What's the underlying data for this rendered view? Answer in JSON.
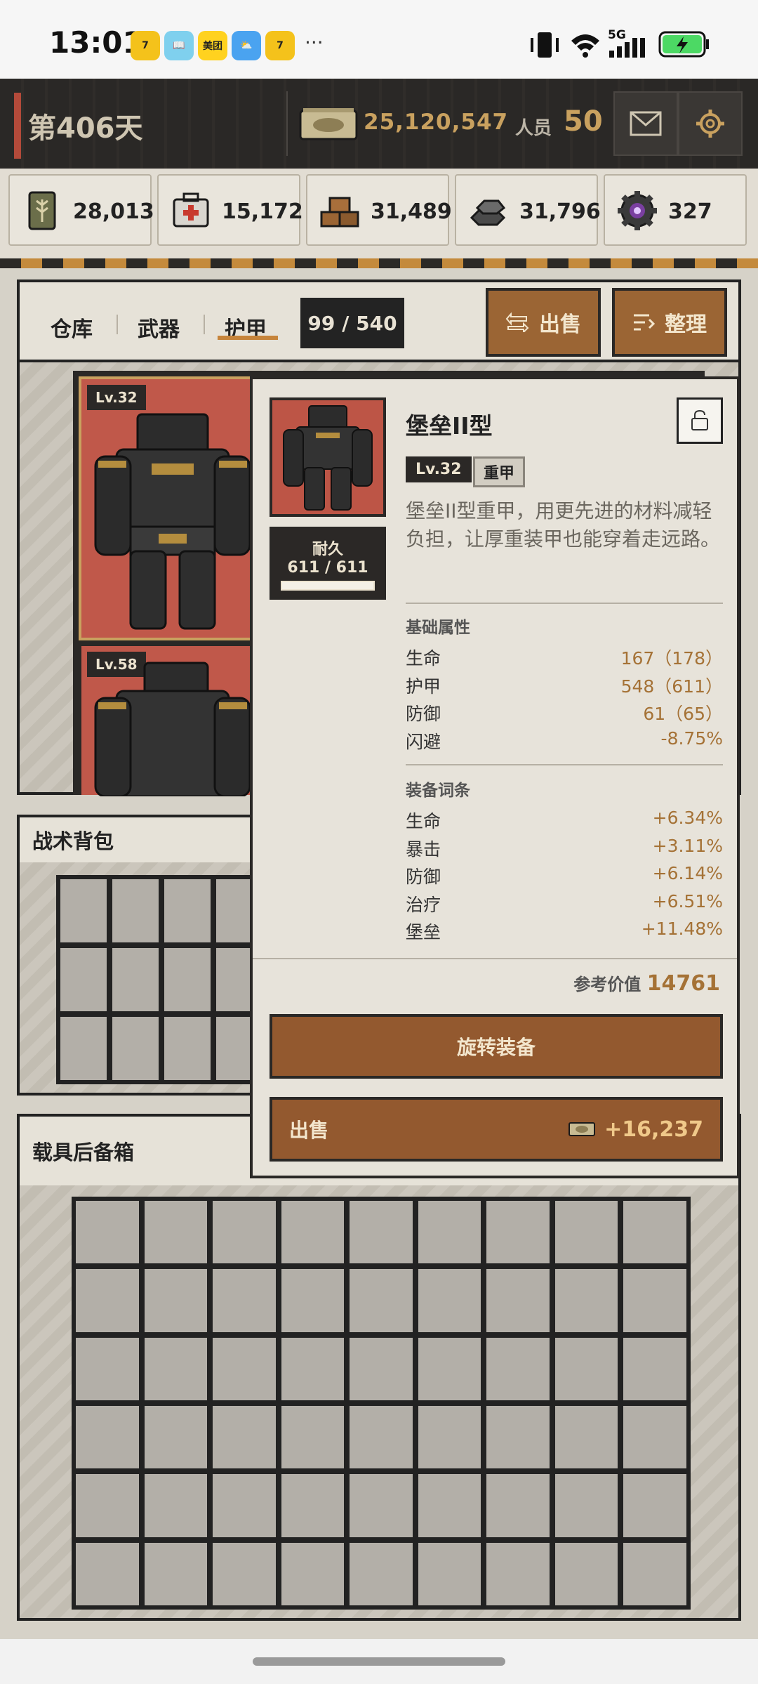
{
  "status_bar": {
    "time": "13:01",
    "apps": [
      "7",
      "📖",
      "美团",
      "⛅",
      "7"
    ],
    "more": "···",
    "network": "5G"
  },
  "header": {
    "day": "第406天",
    "money": "25,120,547",
    "staff_label": "人员",
    "staff_value": "50"
  },
  "resources": [
    {
      "icon": "wheat-can-icon",
      "value": "28,013"
    },
    {
      "icon": "medkit-icon",
      "value": "15,172"
    },
    {
      "icon": "wood-planks-icon",
      "value": "31,489"
    },
    {
      "icon": "metal-ingots-icon",
      "value": "31,796"
    },
    {
      "icon": "gear-core-icon",
      "value": "327"
    }
  ],
  "inventory": {
    "tabs": [
      "仓库",
      "武器",
      "护甲"
    ],
    "active_tab": "护甲",
    "count": "99 / 540",
    "sell_label": "出售",
    "sort_label": "整理",
    "items": [
      {
        "level": "Lv.32"
      },
      {
        "level": "Lv.58"
      }
    ]
  },
  "sections": {
    "backpack": "战术背包",
    "trunk": "载具后备箱"
  },
  "popup": {
    "name": "堡垒II型",
    "level": "Lv.32",
    "type": "重甲",
    "description": "堡垒II型重甲，用更先进的材料减轻负担，让厚重装甲也能穿着走远路。",
    "durability_label": "耐久",
    "durability_value": "611 / 611",
    "durability_fraction": 1.0,
    "base_title": "基础属性",
    "base_stats": [
      {
        "k": "生命",
        "v": "167（178）"
      },
      {
        "k": "护甲",
        "v": "548（611）"
      },
      {
        "k": "防御",
        "v": "61（65）"
      },
      {
        "k": "闪避",
        "v": "-8.75%"
      }
    ],
    "affix_title": "装备词条",
    "affixes": [
      {
        "k": "生命",
        "v": "+6.34%"
      },
      {
        "k": "暴击",
        "v": "+3.11%"
      },
      {
        "k": "防御",
        "v": "+6.14%"
      },
      {
        "k": "治疗",
        "v": "+6.51%"
      },
      {
        "k": "堡垒",
        "v": "+11.48%"
      }
    ],
    "ref_label": "参考价值",
    "ref_value": "14761",
    "rotate_label": "旋转装备",
    "sell_label": "出售",
    "sell_value": "+16,237"
  },
  "colors": {
    "accent_brown": "#9b6534",
    "gold": "#c9a15f",
    "item_red": "#c0584a"
  }
}
